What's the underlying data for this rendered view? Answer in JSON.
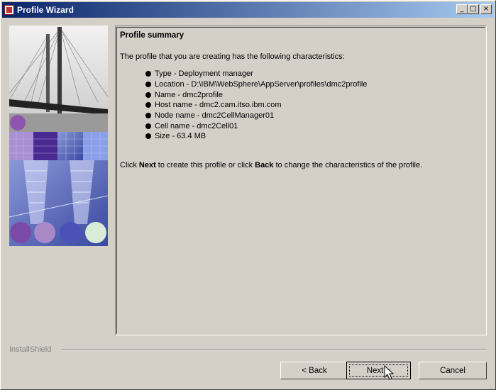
{
  "window": {
    "title": "Profile Wizard"
  },
  "window_controls": {
    "minimize": "_",
    "maximize": "□",
    "close": "×"
  },
  "summary": {
    "heading": "Profile summary",
    "intro": "The profile that you are creating has the following characteristics:",
    "characteristics": [
      "Type - Deployment manager",
      "Location - D:\\IBM\\WebSphere\\AppServer\\profiles\\dmc2profile",
      "Name - dmc2profile",
      "Host name - dmc2.cam.itso.ibm.com",
      "Node name - dmc2CellManager01",
      "Cell name - dmc2Cell01",
      "Size - 63.4 MB"
    ],
    "footer": {
      "part1": "Click ",
      "next_word": "Next",
      "part2": " to create this profile or click ",
      "back_word": "Back",
      "part3": " to change the characteristics of the profile."
    }
  },
  "brand": "InstallShield",
  "buttons": {
    "back": "< Back",
    "next": "Next >",
    "cancel": "Cancel"
  },
  "colors": {
    "titlebar_start": "#0a246a",
    "titlebar_end": "#a6caf0",
    "dialog_bg": "#d4d0c8"
  }
}
